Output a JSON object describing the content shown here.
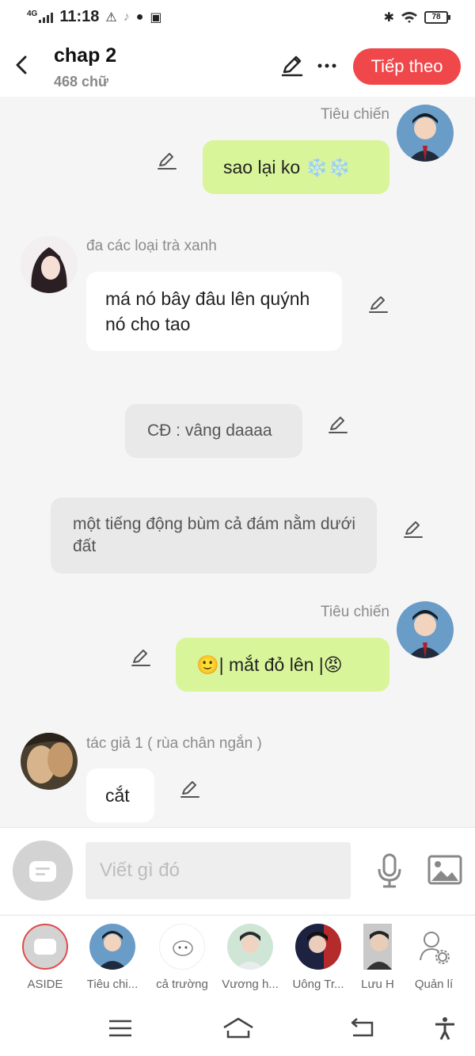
{
  "status_bar": {
    "network": "4G",
    "time": "11:18",
    "battery": "78"
  },
  "header": {
    "title": "chap 2",
    "subtitle": "468 chữ",
    "next_label": "Tiếp theo"
  },
  "messages": [
    {
      "sender": "Tiêu chiến",
      "text": "sao lại ko ❄️❄️",
      "side": "right",
      "style": "green"
    },
    {
      "sender": "đa  các loại trà xanh",
      "text": "má nó bây đâu lên quýnh nó cho tao",
      "side": "left",
      "style": "white"
    },
    {
      "text": "CĐ : vâng daaaa",
      "style": "gray"
    },
    {
      "text": "một tiếng động bùm cả đám nằm dưới đất",
      "style": "gray"
    },
    {
      "sender": "Tiêu chiến",
      "text": "🙂| mắt đỏ lên |😡",
      "side": "right",
      "style": "green"
    },
    {
      "sender": "tác giả 1 ( rùa chân ngắn )",
      "text": "cắt",
      "side": "left",
      "style": "white"
    }
  ],
  "composer": {
    "placeholder": "Viết gì đó"
  },
  "characters": [
    {
      "label": "ASIDE"
    },
    {
      "label": "Tiêu chi..."
    },
    {
      "label": "cả trường"
    },
    {
      "label": "Vương h..."
    },
    {
      "label": "Uông Tr..."
    },
    {
      "label": "Lưu H"
    },
    {
      "label": "Quản lí"
    }
  ],
  "colors": {
    "accent": "#f0474b",
    "bubble_green": "#d9f59a",
    "background": "#f5f5f5"
  }
}
